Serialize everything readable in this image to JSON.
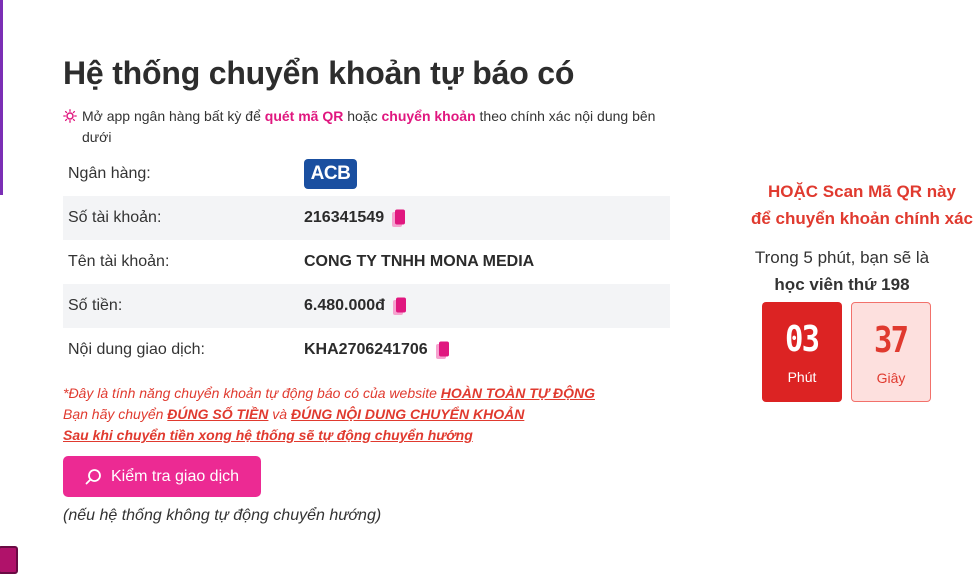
{
  "title": "Hệ thống chuyển khoản tự báo có",
  "instruction": {
    "prefix": "Mở app ngân hàng bất kỳ để ",
    "hl1": "quét mã QR",
    "mid": " hoặc ",
    "hl2": "chuyển khoản",
    "suffix": " theo chính xác nội dung bên dưới"
  },
  "rows": [
    {
      "label": "Ngân hàng:",
      "bank_logo": "ACB"
    },
    {
      "label": "Số tài khoản:",
      "value": "216341549"
    },
    {
      "label": "Tên tài khoản:",
      "value": "CONG TY TNHH MONA MEDIA"
    },
    {
      "label": "Số tiền:",
      "value": "6.480.000đ"
    },
    {
      "label": "Nội dung giao dịch:",
      "value": "KHA2706241706"
    }
  ],
  "notes": {
    "line1_text": "*Đây là tính năng chuyển khoản tự động báo có của website ",
    "line1_u": "HOÀN TOÀN TỰ ĐỘNG",
    "line2_a": "Bạn hãy chuyển ",
    "line2_u1": "ĐÚNG SỐ TIỀN",
    "line2_b": " và ",
    "line2_u2": "ĐÚNG NỘI DUNG CHUYỂN KHOẢN",
    "line3_u": "Sau khi chuyển tiền xong hệ thống sẽ tự động chuyển hướng"
  },
  "check_button": "Kiểm tra giao dịch",
  "sub_note": "(nếu hệ thống không tự động chuyển hướng)",
  "right": {
    "scan_line1": "HOẶC Scan Mã QR này",
    "scan_line2": "để chuyển khoản chính xác",
    "timer_line1": "Trong 5 phút, bạn sẽ là",
    "timer_line2": "học viên thứ 198",
    "minutes": "03",
    "minutes_label": "Phút",
    "seconds": "37",
    "seconds_label": "Giây"
  },
  "colors": {
    "accent_pink": "#ec2a93",
    "highlight_pink": "#e0177f",
    "alert_red": "#e03a2f",
    "timer_red": "#dc2323",
    "bank_blue": "#1a4fa0"
  },
  "icons": [
    "sun-icon",
    "copy-icon",
    "search-icon"
  ]
}
